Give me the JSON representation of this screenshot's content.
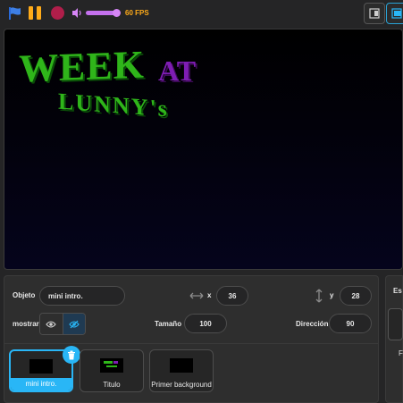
{
  "toolbar": {
    "fps_label": "60 FPS",
    "colors": {
      "accent": "#ffab19",
      "stop": "#b01e4a",
      "volume": "#c471ed",
      "selection": "#29b6f6"
    }
  },
  "stage": {
    "title_line1": "WEEK",
    "title_line1b": "AT",
    "title_line2": "LUNNY's"
  },
  "properties": {
    "object_label": "Objeto",
    "object_value": "mini intro.",
    "x_label": "x",
    "x_value": "36",
    "y_label": "y",
    "y_value": "28",
    "show_label": "mostrar",
    "size_label": "Tamaño",
    "size_value": "100",
    "direction_label": "Dirección",
    "direction_value": "90"
  },
  "sprites": [
    {
      "name": "mini intro.",
      "selected": true
    },
    {
      "name": "Titulo",
      "selected": false
    },
    {
      "name": "Primer background",
      "selected": false
    }
  ],
  "right_panel": {
    "label": "Es",
    "label2": "F"
  }
}
